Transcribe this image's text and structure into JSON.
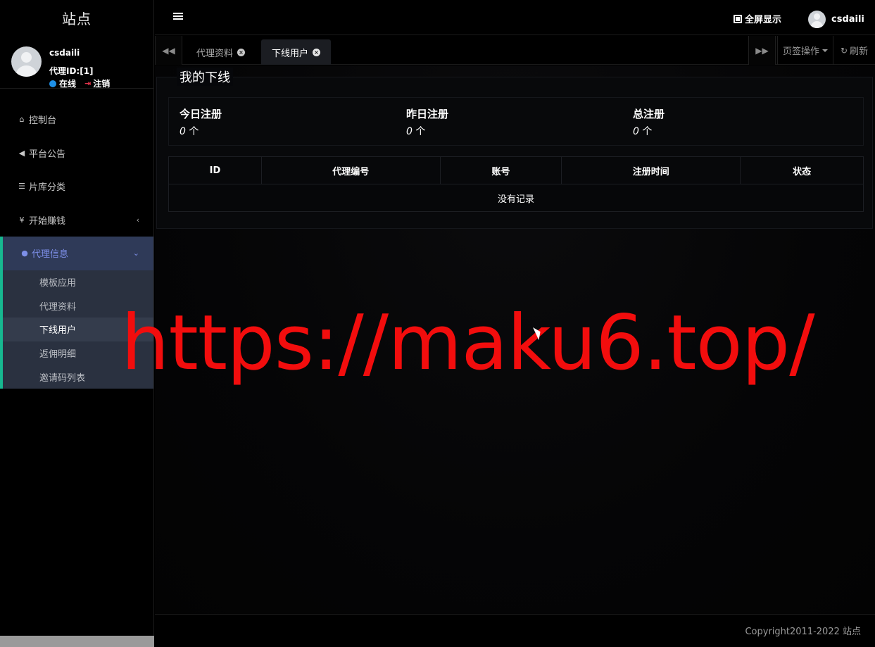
{
  "sidebar": {
    "logo": "站点",
    "user": {
      "name": "csdaili",
      "id_text": "代理ID:[1]",
      "status": "在线",
      "logout": "注销"
    },
    "menu": [
      {
        "label": "控制台",
        "icon": "home-icon"
      },
      {
        "label": "平台公告",
        "icon": "bullhorn-icon"
      },
      {
        "label": "片库分类",
        "icon": "list-icon"
      },
      {
        "label": "开始赚钱",
        "icon": "yen-icon"
      }
    ],
    "group": {
      "label": "代理信息",
      "icon": "user-icon",
      "children": [
        "模板应用",
        "代理资料",
        "下线用户",
        "返佣明细",
        "邀请码列表"
      ],
      "current": "下线用户"
    }
  },
  "topbar": {
    "fullscreen_label": "全屏显示",
    "username": "csdaili"
  },
  "tabs": {
    "items": [
      {
        "label": "代理资料",
        "active": false
      },
      {
        "label": "下线用户",
        "active": true
      }
    ],
    "ops_label": "页签操作",
    "refresh_label": "刷新"
  },
  "main": {
    "panel_title": "我的下线",
    "stats": [
      {
        "label": "今日注册",
        "value": "0",
        "unit": "个"
      },
      {
        "label": "昨日注册",
        "value": "0",
        "unit": "个"
      },
      {
        "label": "总注册",
        "value": "0",
        "unit": "个"
      }
    ],
    "table": {
      "columns": [
        "ID",
        "代理编号",
        "账号",
        "注册时间",
        "状态"
      ],
      "empty_text": "没有记录"
    }
  },
  "footer": {
    "copyright": "Copyright2011-2022 站点"
  },
  "watermark": "https://maku6.top/",
  "colors": {
    "accent": "#7d8fe8",
    "active_border": "#17b890",
    "watermark": "#f20d0d",
    "online_dot": "#1e90e8",
    "logout_icon": "#e0334b"
  }
}
